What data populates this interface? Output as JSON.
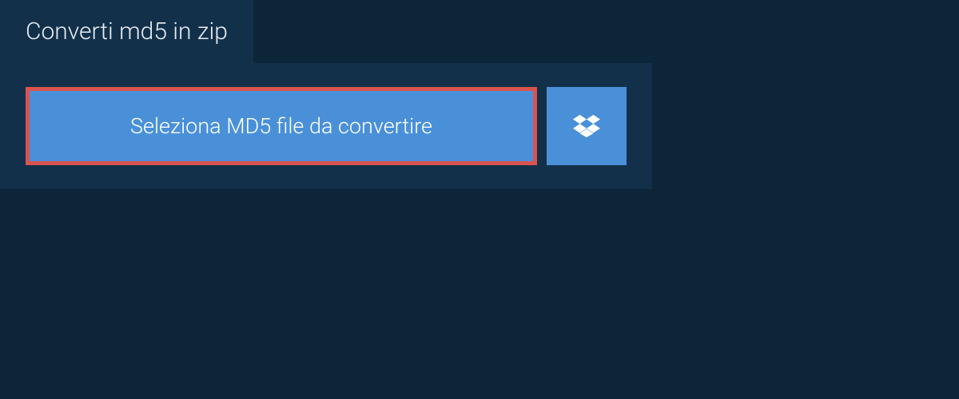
{
  "tab": {
    "label": "Converti md5 in zip"
  },
  "actions": {
    "select_file_label": "Seleziona MD5 file da convertire"
  },
  "colors": {
    "background": "#0d2538",
    "panel": "#12304a",
    "button": "#4a90d9",
    "highlight_border": "#d9534f",
    "text_light": "#e8eef3",
    "text_white": "#ffffff"
  }
}
